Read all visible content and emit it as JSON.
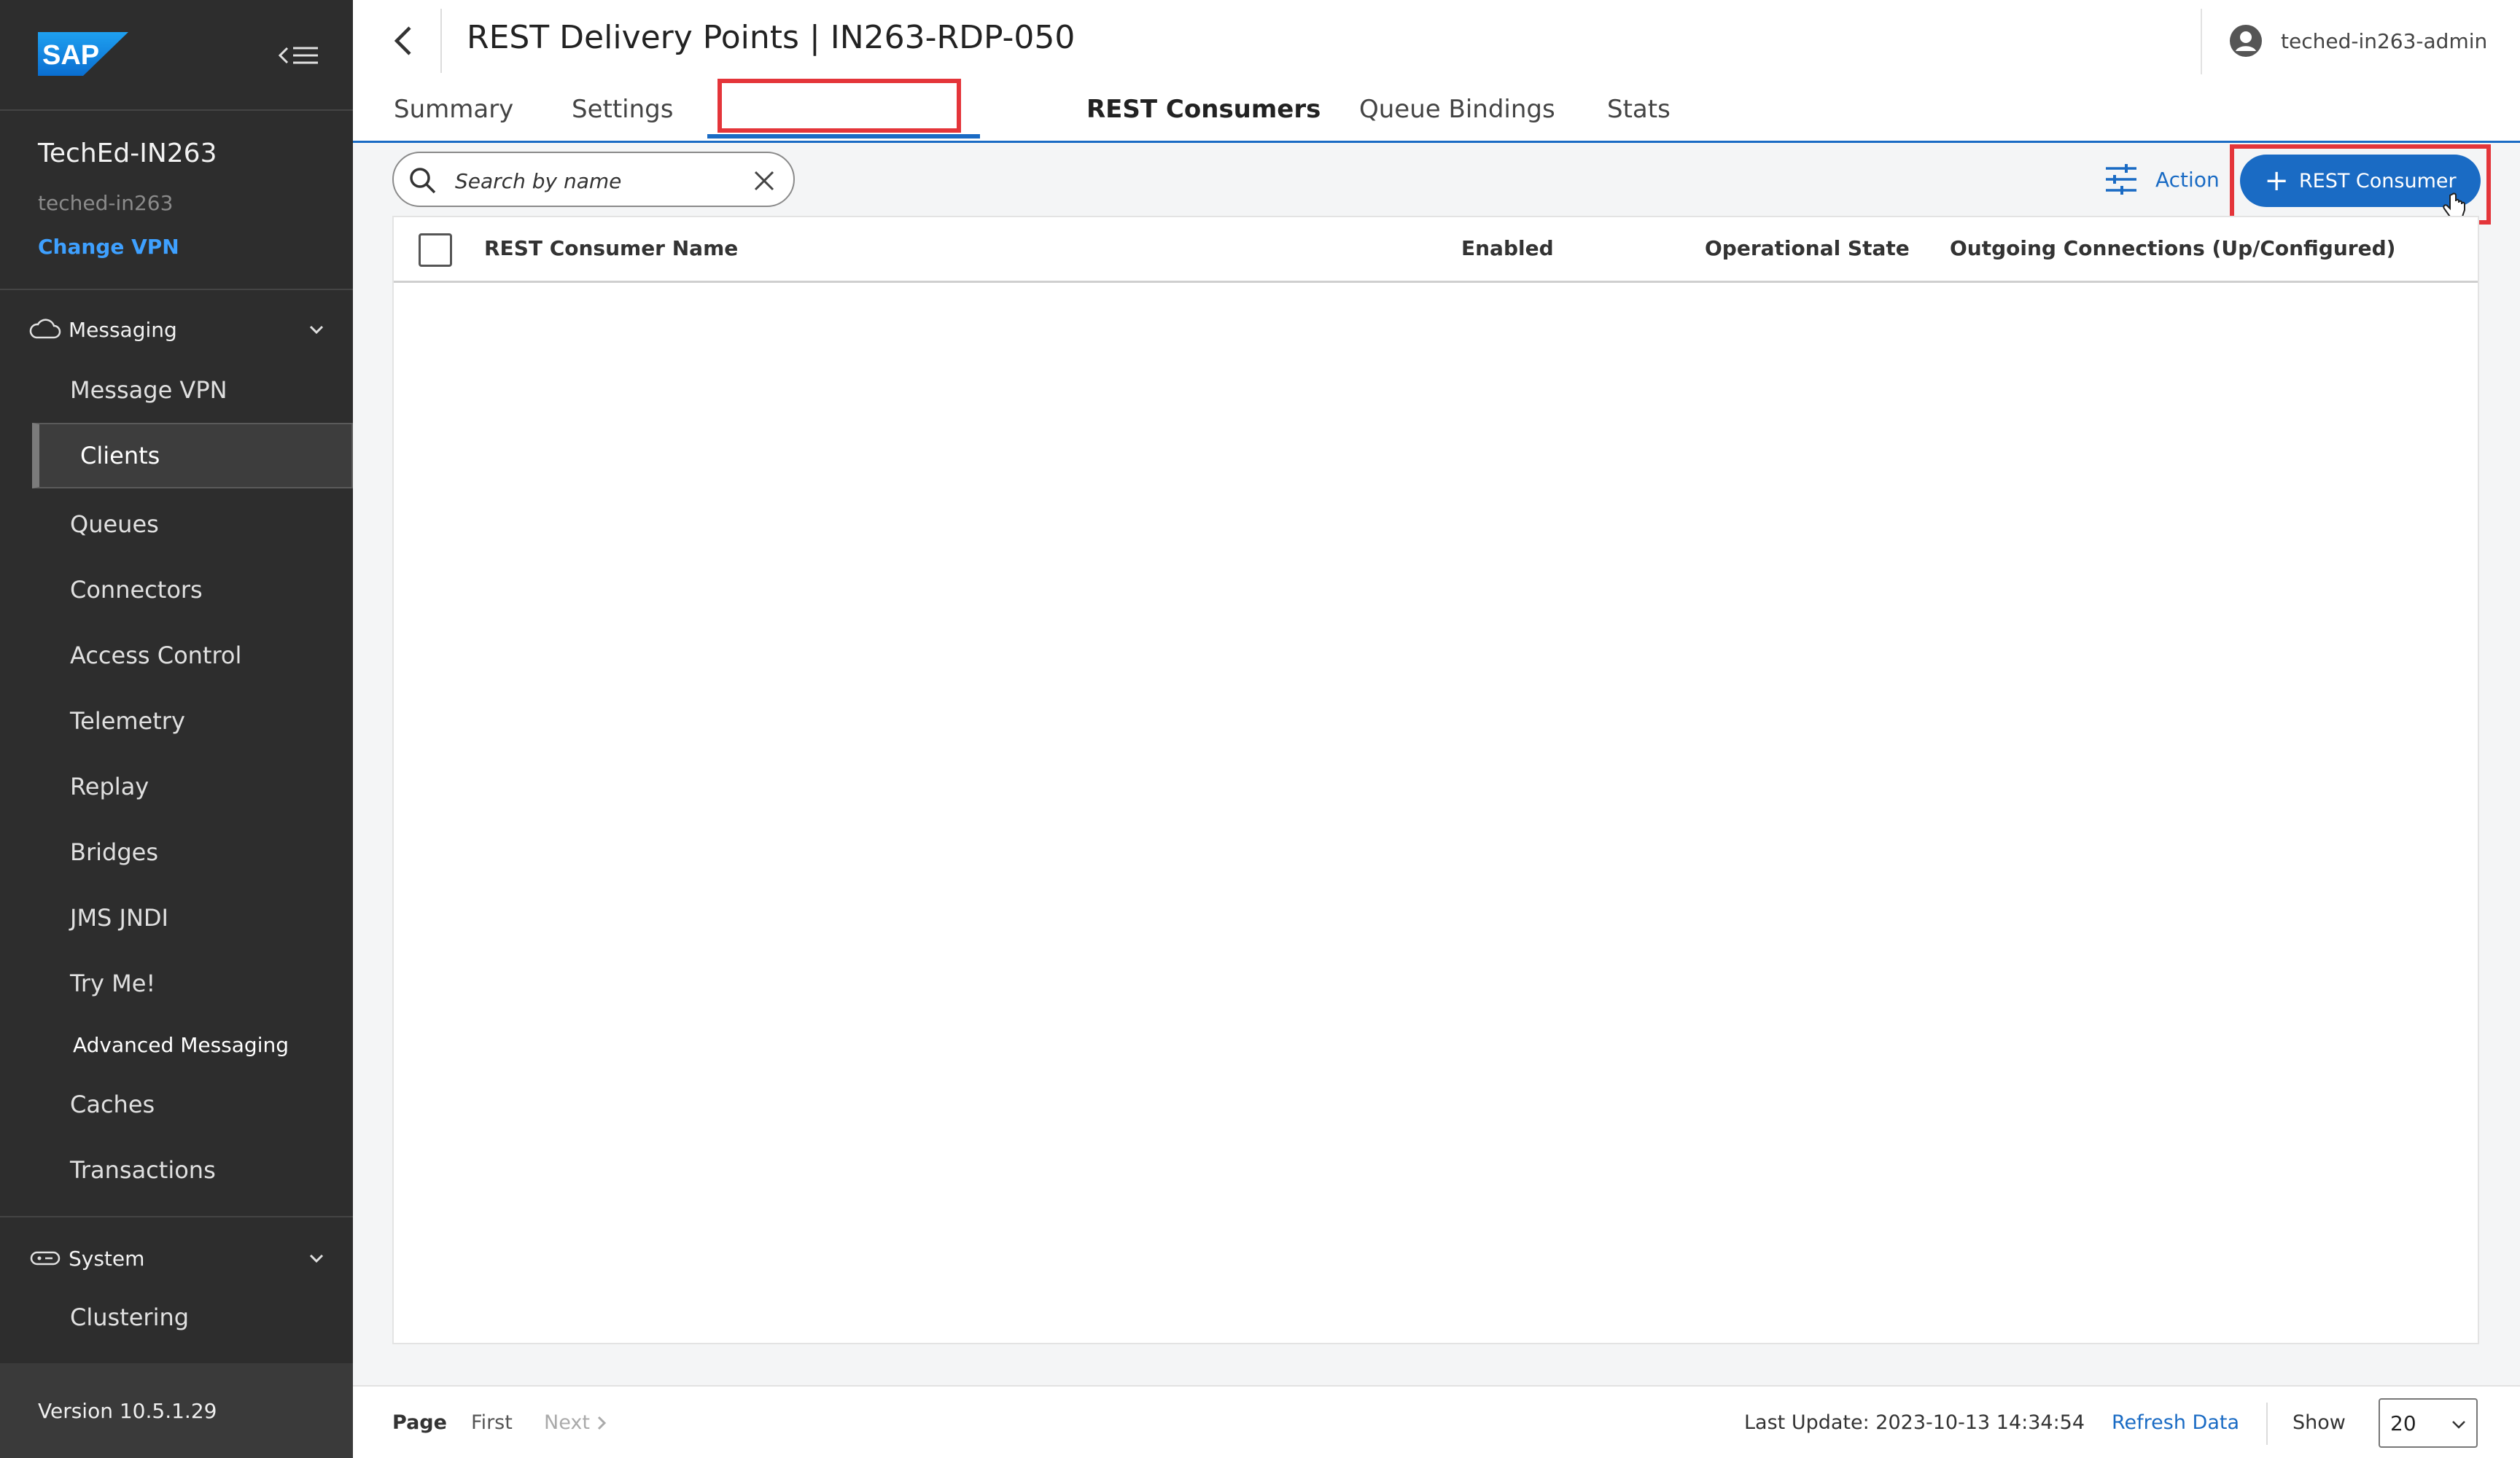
{
  "brand": {
    "logo_text": "SAP",
    "brand_color": "#0a6ed1"
  },
  "sidebar": {
    "vpn_name": "TechEd-IN263",
    "vpn_subtitle": "teched-in263",
    "change_vpn": "Change VPN",
    "messaging": {
      "label": "Messaging",
      "icon": "cloud-icon",
      "items": [
        {
          "label": "Message VPN"
        },
        {
          "label": "Clients",
          "active": true
        },
        {
          "label": "Queues"
        },
        {
          "label": "Connectors"
        },
        {
          "label": "Access Control"
        },
        {
          "label": "Telemetry"
        },
        {
          "label": "Replay"
        },
        {
          "label": "Bridges"
        },
        {
          "label": "JMS JNDI"
        },
        {
          "label": "Try Me!"
        },
        {
          "label": "Advanced Messaging"
        },
        {
          "label": "Caches"
        },
        {
          "label": "Transactions"
        }
      ]
    },
    "system": {
      "label": "System",
      "icon": "server-icon",
      "items": [
        {
          "label": "Clustering"
        }
      ]
    },
    "version": "Version 10.5.1.29"
  },
  "header": {
    "title": "REST Delivery Points | IN263-RDP-050",
    "user": "teched-in263-admin",
    "tabs": [
      {
        "label": "Summary"
      },
      {
        "label": "Settings"
      },
      {
        "label": "REST Consumers",
        "active": true
      },
      {
        "label": "Queue Bindings"
      },
      {
        "label": "Stats"
      }
    ]
  },
  "toolbar": {
    "search_placeholder": "Search by name",
    "action_label": "Action",
    "add_button_label": "REST Consumer"
  },
  "table": {
    "columns": [
      "REST Consumer Name",
      "Enabled",
      "Operational State",
      "Outgoing Connections (Up/Configured)"
    ],
    "rows": []
  },
  "footer": {
    "page_label": "Page",
    "first_label": "First",
    "next_label": "Next",
    "last_update": "Last Update: 2023-10-13 14:34:54",
    "refresh_label": "Refresh Data",
    "show_label": "Show",
    "page_size": "20"
  },
  "colors": {
    "accent": "#1a6bc4",
    "highlight": "#e4353a",
    "sidebar_bg": "#2d2d2d"
  }
}
